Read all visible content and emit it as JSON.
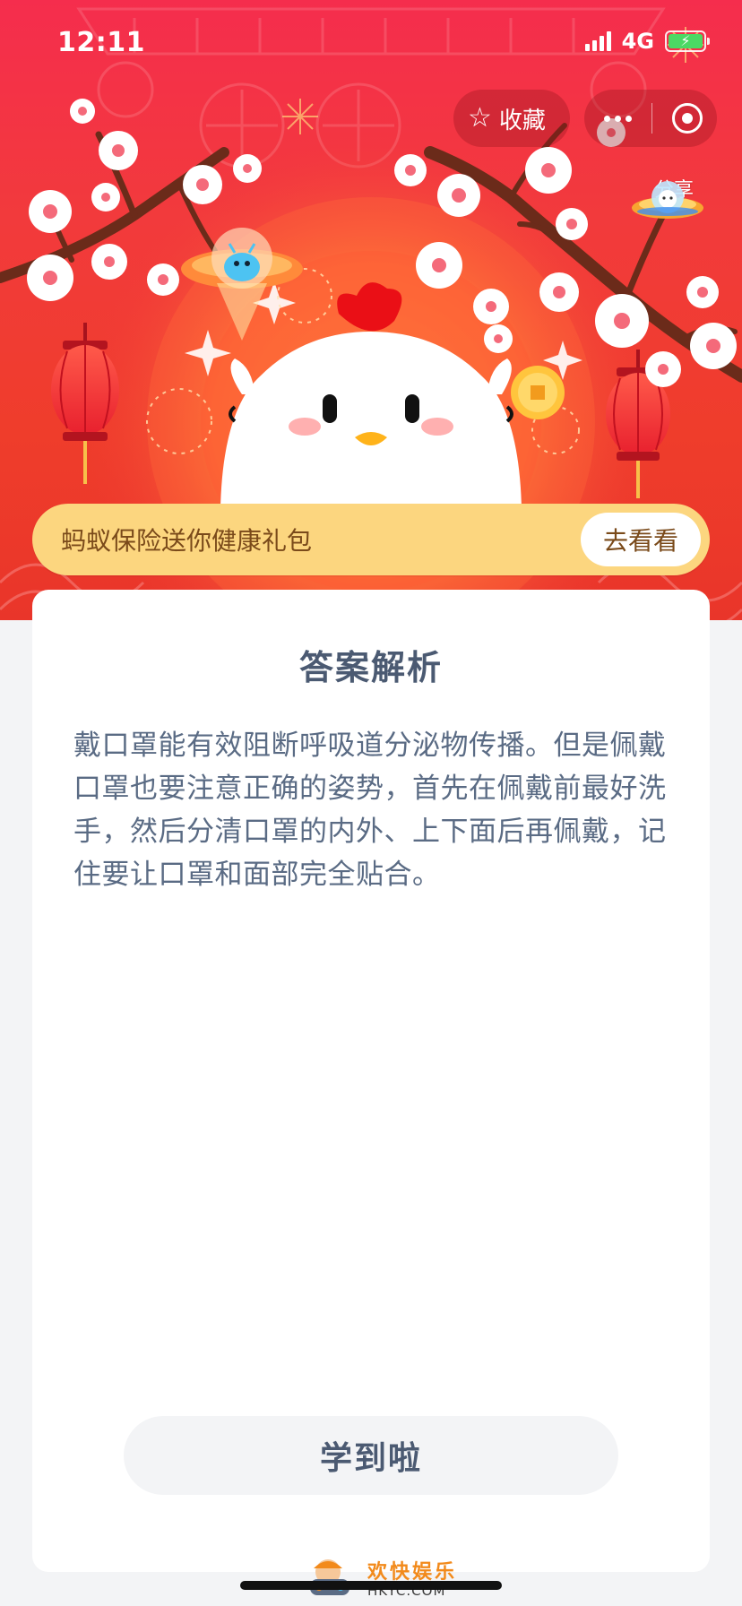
{
  "status_bar": {
    "time": "12:11",
    "network": "4G",
    "icons": [
      "signal-icon",
      "battery-icon"
    ]
  },
  "header": {
    "collect_label": "收藏",
    "collect_icon": "star-outline-icon",
    "capsule_icons": [
      "more-icon",
      "close-mini-program-icon"
    ],
    "share_label": "分享",
    "share_icon": "ufo-icon",
    "illustration": "chicken-mascot-with-plum-blossoms",
    "colors": {
      "background": "#f23a3c",
      "blossom": "#ffffff",
      "branch": "#6b2b1a"
    }
  },
  "promo": {
    "text": "蚂蚁保险送你健康礼包",
    "button_label": "去看看",
    "color": "#fcd67f"
  },
  "card": {
    "title": "答案解析",
    "body": "戴口罩能有效阻断呼吸道分泌物传播。但是佩戴口罩也要注意正确的姿势，首先在佩戴前最好洗手，然后分清口罩的内外、上下面后再佩戴，记住要让口罩和面部完全贴合。",
    "button_label": "学到啦",
    "text_color": "#5a6b84"
  },
  "watermark": {
    "cn": "欢快娱乐",
    "en": "HKYC.COM"
  }
}
